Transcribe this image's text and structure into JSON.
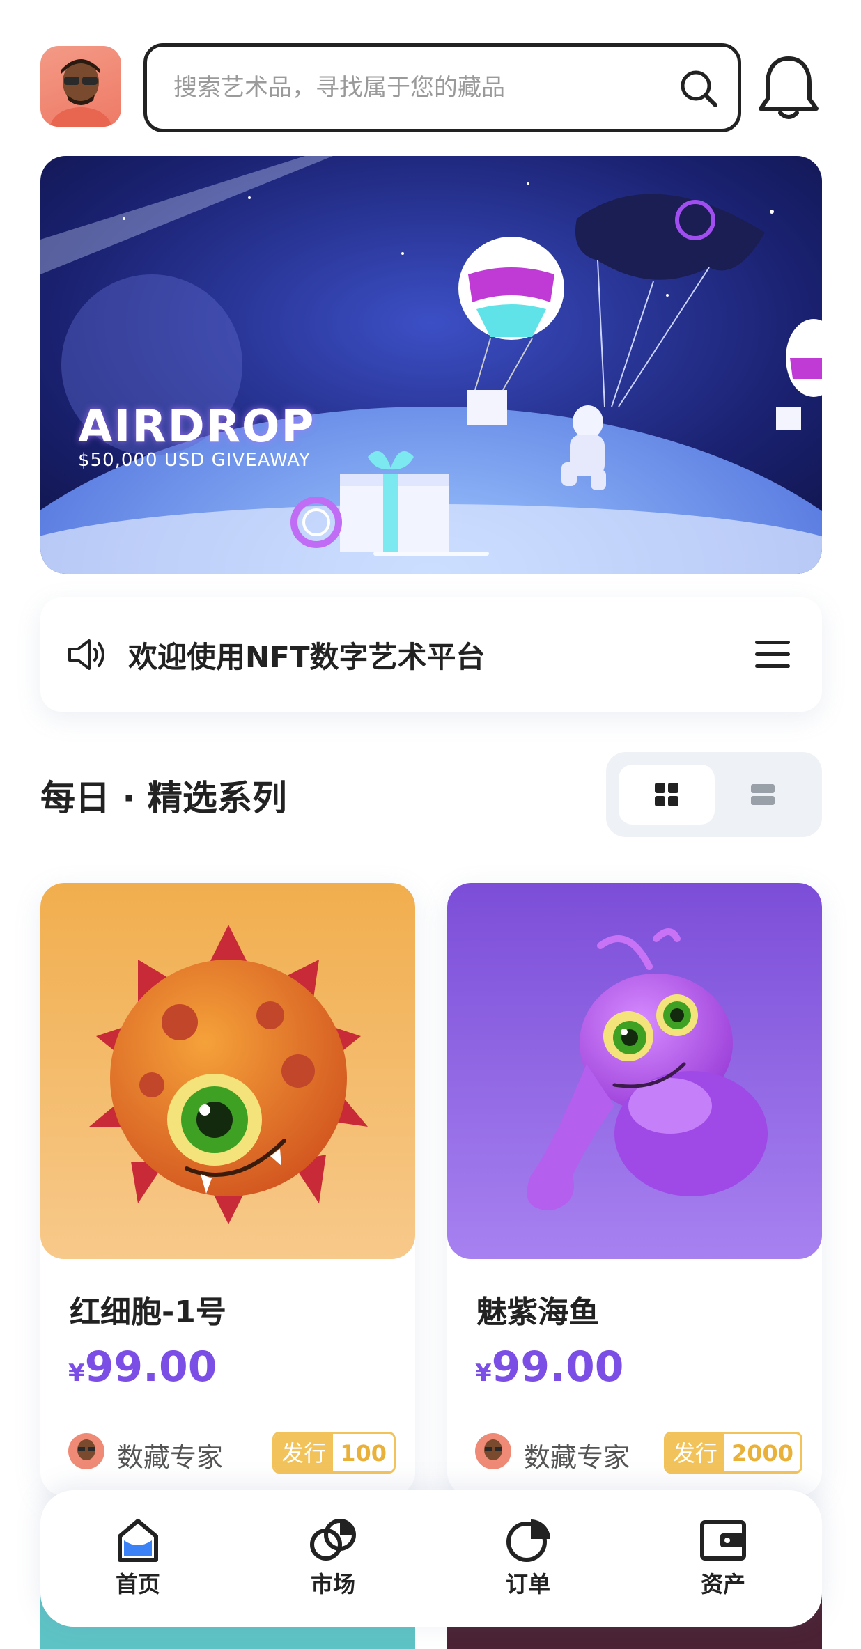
{
  "header": {
    "search_placeholder": "搜索艺术品，寻找属于您的藏品"
  },
  "banner": {
    "title": "AIRDROP",
    "subtitle": "$50,000 USD GIVEAWAY"
  },
  "notice": {
    "text": "欢迎使用NFT数字艺术平台"
  },
  "section": {
    "title": "每日 · 精选系列"
  },
  "cards": [
    {
      "name": "红细胞-1号",
      "currency": "¥",
      "price": "99.00",
      "creator": "数藏专家",
      "issue_label": "发行",
      "issue_count": "100"
    },
    {
      "name": "魅紫海鱼",
      "currency": "¥",
      "price": "99.00",
      "creator": "数藏专家",
      "issue_label": "发行",
      "issue_count": "2000"
    }
  ],
  "tabs": [
    {
      "label": "首页",
      "icon": "home-icon",
      "active": true
    },
    {
      "label": "市场",
      "icon": "market-icon"
    },
    {
      "label": "订单",
      "icon": "pie-chart-icon"
    },
    {
      "label": "资产",
      "icon": "wallet-icon"
    }
  ],
  "colors": {
    "accent": "#7b4ee6",
    "active_tab": "#3b82f6",
    "issue": "#f3c35b"
  }
}
